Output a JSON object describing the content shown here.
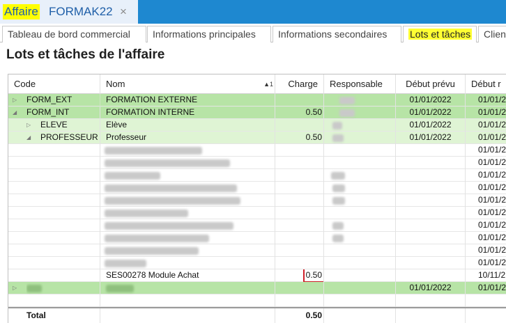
{
  "document_tab": {
    "prefix": "Affaire",
    "name": "FORMAK22",
    "close_glyph": "×"
  },
  "colors": {
    "accent": "#1e88d0",
    "highlight": "#ffff33",
    "group_row": "#b7e4a6",
    "subgroup_row": "#dff4d4",
    "red_box": "#d0202a"
  },
  "tabs": [
    {
      "label": "Tableau de bord commercial"
    },
    {
      "label": "Informations principales"
    },
    {
      "label": "Informations secondaires"
    },
    {
      "label": "Lots et tâches"
    },
    {
      "label": "Clien"
    }
  ],
  "page": {
    "title": "Lots et tâches de l'affaire"
  },
  "grid": {
    "headers": {
      "code": "Code",
      "nom": "Nom",
      "sort_marker": "▲1",
      "charge": "Charge",
      "responsable": "Responsable",
      "debut_prevu": "Début prévu",
      "debut_reel": "Début r"
    },
    "rows": [
      {
        "expander": "▷",
        "code": "FORM_EXT",
        "nom": "FORMATION EXTERNE",
        "charge": "",
        "debut_prevu": "01/01/2022",
        "debut_reel": "01/01/2"
      },
      {
        "expander": "◢",
        "code": "FORM_INT",
        "nom": "FORMATION INTERNE",
        "charge": "0.50",
        "debut_prevu": "01/01/2022",
        "debut_reel": "01/01/2"
      },
      {
        "expander": "▷",
        "code": "ELEVE",
        "nom": "Elève",
        "charge": "",
        "debut_prevu": "01/01/2022",
        "debut_reel": "01/01/2"
      },
      {
        "expander": "◢",
        "code": "PROFESSEUR",
        "nom": "Professeur",
        "charge": "0.50",
        "debut_prevu": "01/01/2022",
        "debut_reel": "01/01/2"
      },
      {
        "debut_reel": "01/01/2"
      },
      {
        "debut_reel": "01/01/2"
      },
      {
        "debut_reel": "01/01/2"
      },
      {
        "debut_reel": "01/01/2"
      },
      {
        "debut_reel": "01/01/2"
      },
      {
        "debut_reel": "01/01/2"
      },
      {
        "debut_reel": "01/01/2"
      },
      {
        "debut_reel": "01/01/2"
      },
      {
        "debut_reel": "01/01/2"
      },
      {
        "debut_reel": "01/01/2"
      },
      {
        "nom": "SES00278 Module Achat",
        "charge": "0.50",
        "debut_reel": "10/11/2"
      },
      {
        "expander": "▷",
        "debut_prevu": "01/01/2022",
        "debut_reel": "01/01/2"
      }
    ],
    "total": {
      "label": "Total",
      "charge": "0.50"
    }
  }
}
